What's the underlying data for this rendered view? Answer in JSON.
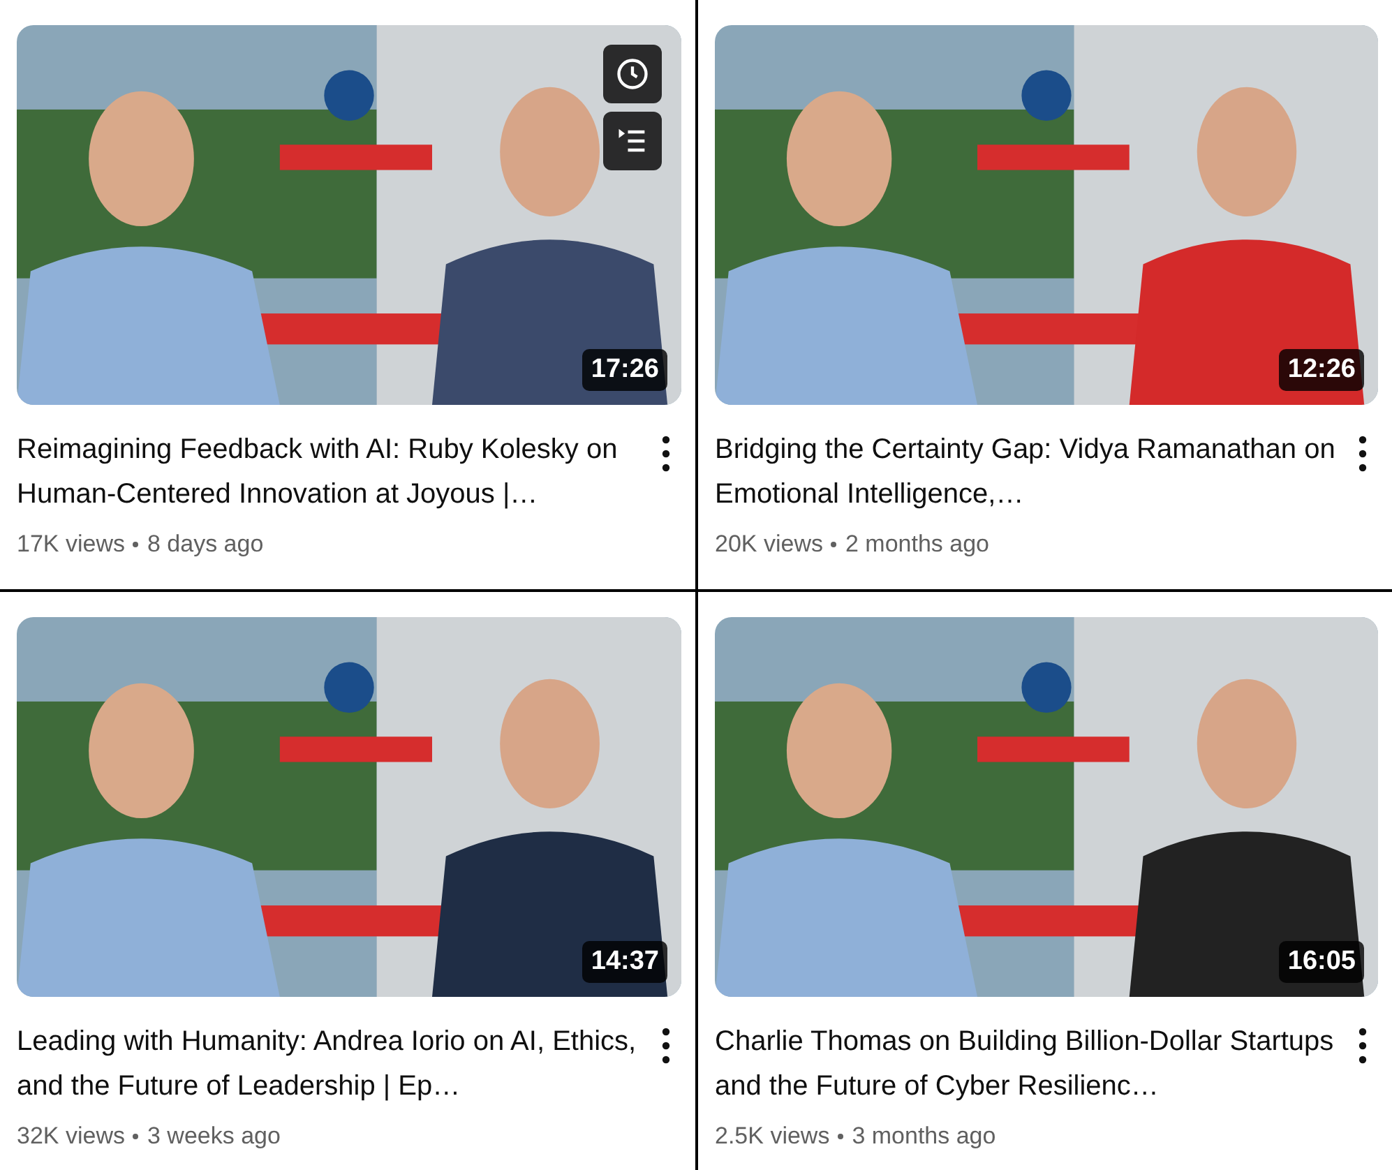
{
  "videos": [
    {
      "title": "Reimagining Feedback with AI: Ruby Kolesky on Human-Centered Innovation at Joyous |…",
      "views": "17K views",
      "age": "8 days ago",
      "duration": "17:26",
      "hover": true
    },
    {
      "title": "Bridging the Certainty Gap: Vidya Ramanathan on Emotional Intelligence,…",
      "views": "20K views",
      "age": "2 months ago",
      "duration": "12:26",
      "hover": false
    },
    {
      "title": "Leading with Humanity: Andrea Iorio on AI, Ethics, and the Future of Leadership | Ep…",
      "views": "32K views",
      "age": "3 weeks ago",
      "duration": "14:37",
      "hover": false
    },
    {
      "title": "Charlie Thomas on Building Billion-Dollar Startups and the Future of Cyber Resilienc…",
      "views": "2.5K views",
      "age": "3 months ago",
      "duration": "16:05",
      "hover": false
    }
  ]
}
